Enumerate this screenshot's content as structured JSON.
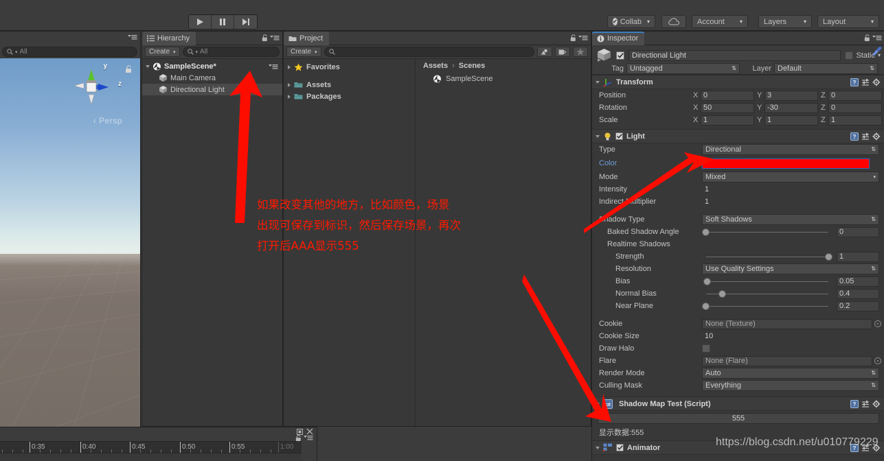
{
  "toolbar": {
    "play_icon": "play-icon",
    "pause_icon": "pause-icon",
    "step_icon": "step-icon",
    "collab_label": "Collab",
    "cloud_icon": "cloud-icon",
    "account_label": "Account",
    "layers_label": "Layers",
    "layout_label": "Layout",
    "caret": "▾"
  },
  "scene": {
    "search_placeholder": "All",
    "gizmo": {
      "y_label": "y",
      "z_label": "z",
      "persp_label": "Persp"
    },
    "lock_icon": "lock-icon"
  },
  "hierarchy": {
    "tab_label": "Hierarchy",
    "create_label": "Create",
    "create_caret": "▾",
    "search_placeholder": "All",
    "scene_name": "SampleScene*",
    "items": [
      {
        "label": "Main Camera",
        "selected": false
      },
      {
        "label": "Directional Light",
        "selected": true
      }
    ]
  },
  "project": {
    "tab_label": "Project",
    "create_label": "Create",
    "create_caret": "▾",
    "search_placeholder": "",
    "icons": [
      "avatar-filter-icon",
      "label-filter-icon",
      "favorite-star-icon"
    ],
    "tree": [
      {
        "label": "Favorites",
        "icon": "star-icon"
      },
      {
        "label": "Assets",
        "icon": "folder-icon"
      },
      {
        "label": "Packages",
        "icon": "folder-icon"
      }
    ],
    "breadcrumb": {
      "root": "Assets",
      "sep": "›",
      "leaf": "Scenes"
    },
    "assets": [
      {
        "label": "SampleScene",
        "icon": "unity-scene-icon"
      }
    ]
  },
  "inspector": {
    "tab_label": "Inspector",
    "object_name": "Directional Light",
    "object_enabled": true,
    "static_label": "Static",
    "static_checked": false,
    "tag_label": "Tag",
    "tag_value": "Untagged",
    "layer_label": "Layer",
    "layer_value": "Default",
    "components": [
      {
        "title": "Transform",
        "icon": "transform-icon",
        "rows": [
          {
            "label": "Position",
            "x": "0",
            "y": "3",
            "z": "0"
          },
          {
            "label": "Rotation",
            "x": "50",
            "y": "-30",
            "z": "0"
          },
          {
            "label": "Scale",
            "x": "1",
            "y": "1",
            "z": "1"
          }
        ]
      },
      {
        "title": "Light",
        "icon": "light-bulb-icon",
        "enabled": true,
        "type_label": "Type",
        "type_value": "Directional",
        "color_label": "Color",
        "color_value": "#FE0000",
        "mode_label": "Mode",
        "mode_value": "Mixed",
        "intensity_label": "Intensity",
        "intensity_value": "1",
        "indirect_label": "Indirect Multiplier",
        "indirect_value": "1",
        "shadow_type_label": "Shadow Type",
        "shadow_type_value": "Soft Shadows",
        "baked_angle_label": "Baked Shadow Angle",
        "baked_angle_value": "0",
        "realtime_label": "Realtime Shadows",
        "strength_label": "Strength",
        "strength_value": "1",
        "resolution_label": "Resolution",
        "resolution_value": "Use Quality Settings",
        "bias_label": "Bias",
        "bias_value": "0.05",
        "normal_bias_label": "Normal Bias",
        "normal_bias_value": "0.4",
        "near_plane_label": "Near Plane",
        "near_plane_value": "0.2",
        "cookie_label": "Cookie",
        "cookie_value": "None (Texture)",
        "cookie_size_label": "Cookie Size",
        "cookie_size_value": "10",
        "draw_halo_label": "Draw Halo",
        "draw_halo_checked": false,
        "flare_label": "Flare",
        "flare_value": "None (Flare)",
        "render_mode_label": "Render Mode",
        "render_mode_value": "Auto",
        "culling_mask_label": "Culling Mask",
        "culling_mask_value": "Everything"
      },
      {
        "title": "Shadow Map Test (Script)",
        "icon": "csharp-script-icon",
        "big_value": "555",
        "note": "显示数据:555"
      },
      {
        "title": "Animator",
        "icon": "animator-icon",
        "enabled": true
      }
    ]
  },
  "timeline": {
    "labels": [
      "0:35",
      "0:40",
      "0:45",
      "0:50",
      "0:55",
      "1:00"
    ],
    "close_icon": "close-icon",
    "maximize_icon": "maximize-icon",
    "lock_icon": "lock-icon"
  },
  "annotation": {
    "text": "如果改变其他的地方，比如颜色，场景\n出现可保存到标识，然后保存场景，再次\n打开后AAA显示555",
    "color": "#FF1A00"
  },
  "watermark": {
    "text": "https://blog.csdn.net/u010779229"
  }
}
